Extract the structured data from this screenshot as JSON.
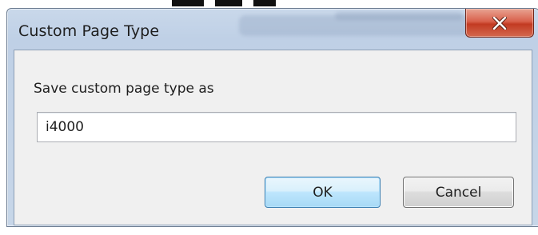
{
  "dialog": {
    "title": "Custom Page Type",
    "prompt": "Save custom page type as",
    "input_value": "i4000",
    "ok_label": "OK",
    "cancel_label": "Cancel",
    "close_icon": "close-icon"
  },
  "colors": {
    "close_button": "#c9452e",
    "ok_button_border": "#3c7fb1",
    "client_bg": "#f0f0f0",
    "frame": "#c5d5e9"
  }
}
